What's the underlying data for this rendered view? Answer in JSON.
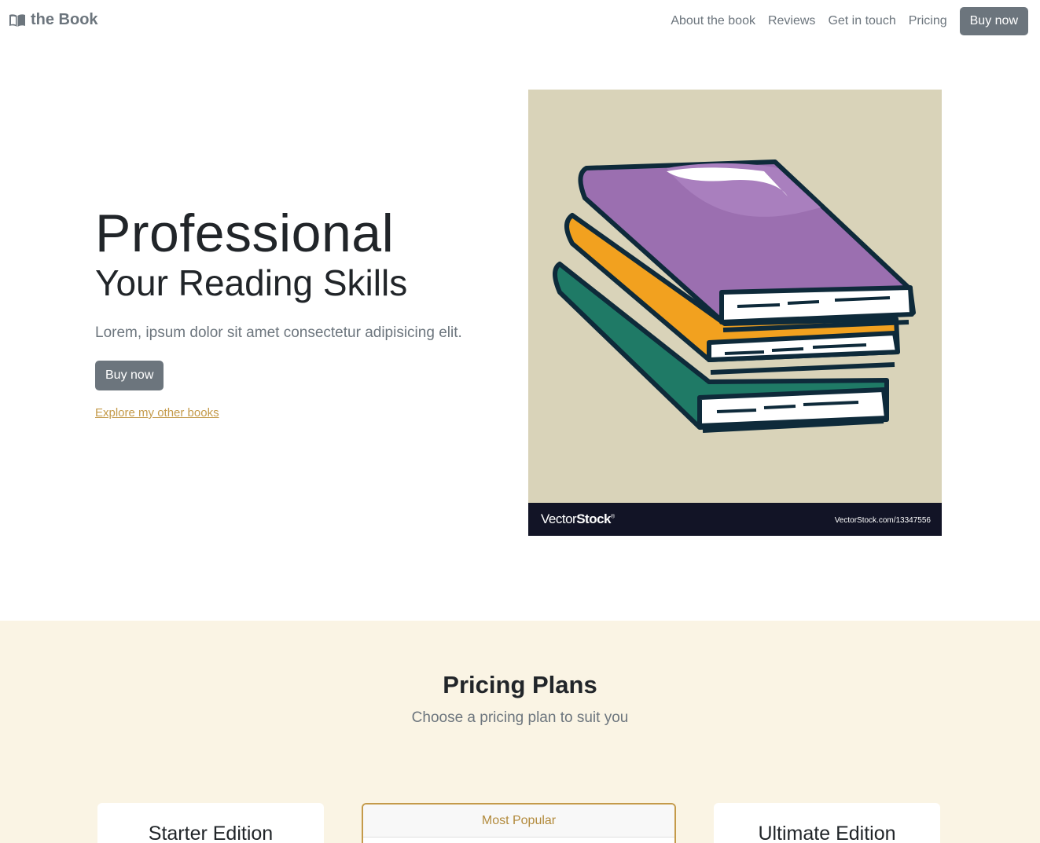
{
  "nav": {
    "brand": "the Book",
    "links": [
      "About the book",
      "Reviews",
      "Get in touch",
      "Pricing"
    ],
    "cta": "Buy now"
  },
  "hero": {
    "title": "Professional",
    "subtitle": "Your Reading Skills",
    "lead": "Lorem, ipsum dolor sit amet consectetur adipisicing elit.",
    "button": "Buy now",
    "link": "Explore my other books",
    "image": {
      "watermark_brand_light": "Vector",
      "watermark_brand_bold": "Stock",
      "watermark_mark": "®",
      "watermark_url": "VectorStock.com/13347556"
    }
  },
  "pricing": {
    "title": "Pricing Plans",
    "subtitle": "Choose a pricing plan to suit you",
    "plans": [
      {
        "name": "Starter Edition"
      },
      {
        "badge": "Most Popular"
      },
      {
        "name": "Ultimate Edition"
      }
    ]
  },
  "colors": {
    "primary": "#6c757d",
    "accent": "#c49a4a",
    "pricing_bg": "#faf4e4",
    "image_bg": "#d9d3b9",
    "book_purple": "#9b6fb0",
    "book_orange": "#f2a11f",
    "book_green": "#1f7a66"
  }
}
